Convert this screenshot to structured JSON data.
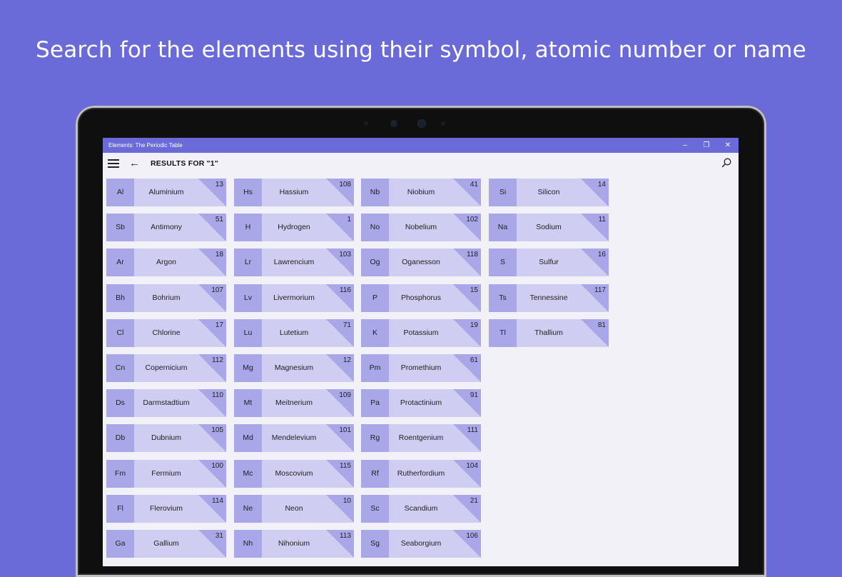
{
  "headline": "Search for the elements using their symbol, atomic number or name",
  "window": {
    "title": "Elements: The Periodic Table",
    "min": "–",
    "max": "❐",
    "close": "✕"
  },
  "toolbar": {
    "back": "←",
    "results_label": "RESULTS FOR \"1\""
  },
  "colors": {
    "accent": "#6a6ad8",
    "card": "#cfcdf1",
    "card_dark": "#a9a7e8"
  },
  "columns": [
    [
      {
        "symbol": "Al",
        "name": "Aluminium",
        "number": "13"
      },
      {
        "symbol": "Sb",
        "name": "Antimony",
        "number": "51"
      },
      {
        "symbol": "Ar",
        "name": "Argon",
        "number": "18"
      },
      {
        "symbol": "Bh",
        "name": "Bohrium",
        "number": "107"
      },
      {
        "symbol": "Cl",
        "name": "Chlorine",
        "number": "17"
      },
      {
        "symbol": "Cn",
        "name": "Copernicium",
        "number": "112"
      },
      {
        "symbol": "Ds",
        "name": "Darmstadtium",
        "number": "110"
      },
      {
        "symbol": "Db",
        "name": "Dubnium",
        "number": "105"
      },
      {
        "symbol": "Fm",
        "name": "Fermium",
        "number": "100"
      },
      {
        "symbol": "Fl",
        "name": "Flerovium",
        "number": "114"
      },
      {
        "symbol": "Ga",
        "name": "Gallium",
        "number": "31"
      }
    ],
    [
      {
        "symbol": "Hs",
        "name": "Hassium",
        "number": "108"
      },
      {
        "symbol": "H",
        "name": "Hydrogen",
        "number": "1"
      },
      {
        "symbol": "Lr",
        "name": "Lawrencium",
        "number": "103"
      },
      {
        "symbol": "Lv",
        "name": "Livermorium",
        "number": "116"
      },
      {
        "symbol": "Lu",
        "name": "Lutetium",
        "number": "71"
      },
      {
        "symbol": "Mg",
        "name": "Magnesium",
        "number": "12"
      },
      {
        "symbol": "Mt",
        "name": "Meitnerium",
        "number": "109"
      },
      {
        "symbol": "Md",
        "name": "Mendelevium",
        "number": "101"
      },
      {
        "symbol": "Mc",
        "name": "Moscovium",
        "number": "115"
      },
      {
        "symbol": "Ne",
        "name": "Neon",
        "number": "10"
      },
      {
        "symbol": "Nh",
        "name": "Nihonium",
        "number": "113"
      }
    ],
    [
      {
        "symbol": "Nb",
        "name": "Niobium",
        "number": "41"
      },
      {
        "symbol": "No",
        "name": "Nobelium",
        "number": "102"
      },
      {
        "symbol": "Og",
        "name": "Oganesson",
        "number": "118"
      },
      {
        "symbol": "P",
        "name": "Phosphorus",
        "number": "15"
      },
      {
        "symbol": "K",
        "name": "Potassium",
        "number": "19"
      },
      {
        "symbol": "Pm",
        "name": "Promethium",
        "number": "61"
      },
      {
        "symbol": "Pa",
        "name": "Protactinium",
        "number": "91"
      },
      {
        "symbol": "Rg",
        "name": "Roentgenium",
        "number": "111"
      },
      {
        "symbol": "Rf",
        "name": "Rutherfordium",
        "number": "104"
      },
      {
        "symbol": "Sc",
        "name": "Scandium",
        "number": "21"
      },
      {
        "symbol": "Sg",
        "name": "Seaborgium",
        "number": "106"
      }
    ],
    [
      {
        "symbol": "Si",
        "name": "Silicon",
        "number": "14"
      },
      {
        "symbol": "Na",
        "name": "Sodium",
        "number": "11"
      },
      {
        "symbol": "S",
        "name": "Sulfur",
        "number": "16"
      },
      {
        "symbol": "Ts",
        "name": "Tennessine",
        "number": "117"
      },
      {
        "symbol": "Tl",
        "name": "Thallium",
        "number": "81"
      }
    ]
  ]
}
